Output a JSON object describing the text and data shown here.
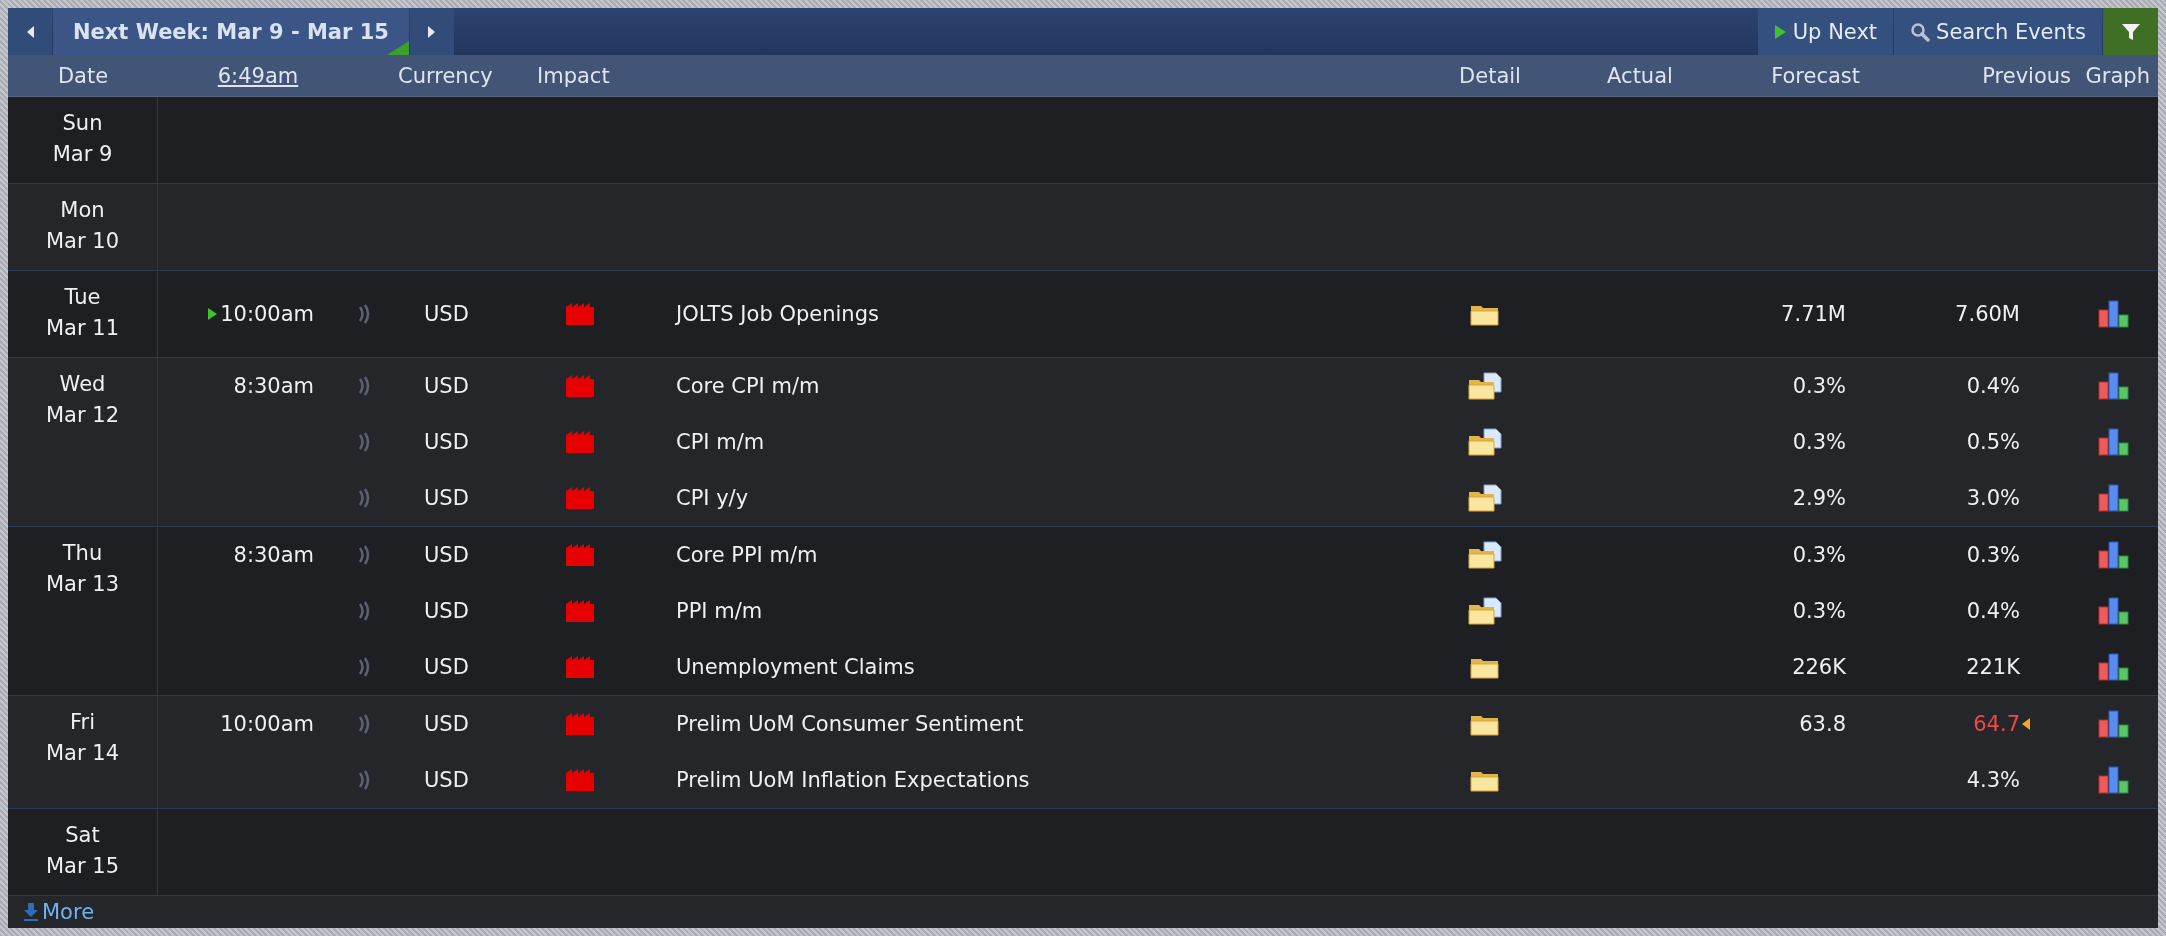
{
  "nav": {
    "title": "Next Week: Mar 9 - Mar 15"
  },
  "actions": [
    {
      "kind": "up-next",
      "label": "Up Next"
    },
    {
      "kind": "search",
      "label": "Search Events"
    }
  ],
  "columns": {
    "date": "Date",
    "time": "6:49am",
    "currency": "Currency",
    "impact": "Impact",
    "detail": "Detail",
    "actual": "Actual",
    "forecast": "Forecast",
    "previous": "Previous",
    "graph": "Graph"
  },
  "days": [
    {
      "weekday": "Sun",
      "date": "Mar 9"
    },
    {
      "weekday": "Mon",
      "date": "Mar 10"
    },
    {
      "weekday": "Tue",
      "date": "Mar 11",
      "events": [
        {
          "time": "10:00am",
          "up_next": true,
          "currency": "USD",
          "color": "#e60000",
          "title": "JOLTS Job Openings",
          "kind": "folder",
          "forecast": "7.71M",
          "previous": "7.60M",
          "revised": false
        }
      ]
    },
    {
      "weekday": "Wed",
      "date": "Mar 12",
      "events": [
        {
          "time": "8:30am",
          "up_next": false,
          "currency": "USD",
          "color": "#e60000",
          "title": "Core CPI m/m",
          "kind": "folder-doc",
          "forecast": "0.3%",
          "previous": "0.4%",
          "revised": false
        },
        {
          "up_next": false,
          "currency": "USD",
          "color": "#e60000",
          "title": "CPI m/m",
          "kind": "folder-doc",
          "forecast": "0.3%",
          "previous": "0.5%",
          "revised": false
        },
        {
          "up_next": false,
          "currency": "USD",
          "color": "#e60000",
          "title": "CPI y/y",
          "kind": "folder-doc",
          "forecast": "2.9%",
          "previous": "3.0%",
          "revised": false
        }
      ]
    },
    {
      "weekday": "Thu",
      "date": "Mar 13",
      "events": [
        {
          "time": "8:30am",
          "up_next": false,
          "currency": "USD",
          "color": "#e60000",
          "title": "Core PPI m/m",
          "kind": "folder-doc",
          "forecast": "0.3%",
          "previous": "0.3%",
          "revised": false
        },
        {
          "up_next": false,
          "currency": "USD",
          "color": "#e60000",
          "title": "PPI m/m",
          "kind": "folder-doc",
          "forecast": "0.3%",
          "previous": "0.4%",
          "revised": false
        },
        {
          "up_next": false,
          "currency": "USD",
          "color": "#e60000",
          "title": "Unemployment Claims",
          "kind": "folder",
          "forecast": "226K",
          "previous": "221K",
          "revised": false
        }
      ]
    },
    {
      "weekday": "Fri",
      "date": "Mar 14",
      "events": [
        {
          "time": "10:00am",
          "up_next": false,
          "currency": "USD",
          "color": "#e60000",
          "title": "Prelim UoM Consumer Sentiment",
          "kind": "folder",
          "forecast": "63.8",
          "previous": "64.7",
          "revised": true
        },
        {
          "up_next": false,
          "currency": "USD",
          "color": "#e60000",
          "title": "Prelim UoM Inflation Expectations",
          "kind": "folder",
          "previous": "4.3%",
          "revised": false
        }
      ]
    },
    {
      "weekday": "Sat",
      "date": "Mar 15"
    }
  ],
  "more": "More"
}
